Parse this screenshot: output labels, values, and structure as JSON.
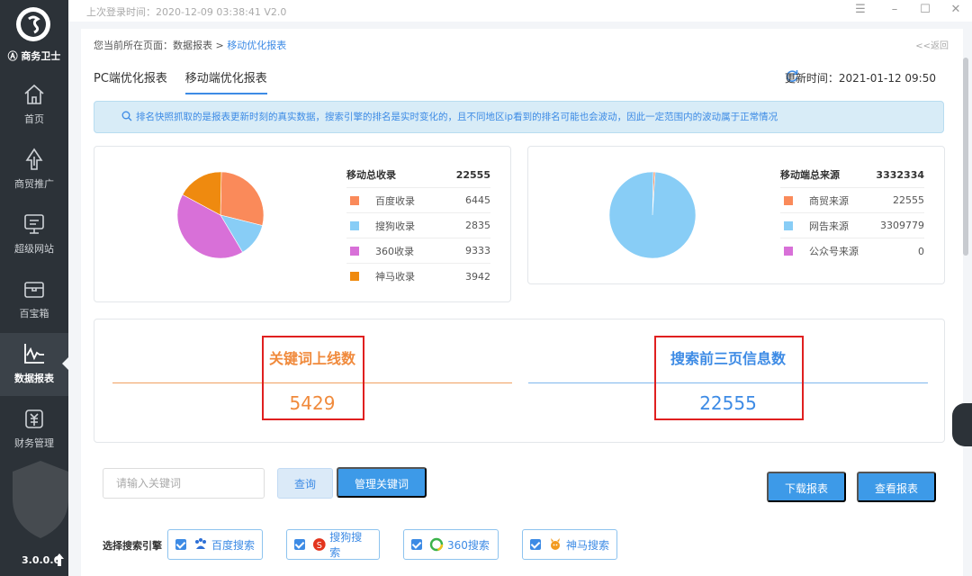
{
  "app": {
    "brand": "商务卫士",
    "last_login": "上次登录时间：2020-12-09 03:38:41 V2.0",
    "version": "3.0.0.6"
  },
  "sidebar": {
    "items": [
      {
        "label": "首页",
        "icon": "home-icon"
      },
      {
        "label": "商贸推广",
        "icon": "rocket-icon"
      },
      {
        "label": "超级网站",
        "icon": "monitor-icon"
      },
      {
        "label": "百宝箱",
        "icon": "treasure-box-icon"
      },
      {
        "label": "数据报表",
        "icon": "chart-line-icon",
        "active": true
      },
      {
        "label": "财务管理",
        "icon": "finance-icon"
      }
    ]
  },
  "breadcrumb": {
    "prefix": "您当前所在页面：数据报表 >",
    "current": "移动优化报表",
    "back": "<<返回"
  },
  "tabs": [
    {
      "label": "PC端优化报表",
      "active": false
    },
    {
      "label": "移动端优化报表",
      "active": true
    }
  ],
  "update_time": "更新时间：2021-01-12 09:50",
  "notice": "排名快照抓取的是报表更新时刻的真实数据，搜索引擎的排名是实时变化的，且不同地区ip看到的排名可能也会波动，因此一定范围内的波动属于正常情况",
  "colors": {
    "orange": "#fa8a5a",
    "light_blue": "#88cdf6",
    "purple": "#d870d8",
    "amber": "#ef8a0f",
    "accent": "#3d8be5"
  },
  "chart_data": [
    {
      "type": "pie",
      "title": "移动总收录",
      "total": "22555",
      "categories": [
        "百度收录",
        "搜狗收录",
        "360收录",
        "神马收录"
      ],
      "values": [
        6445,
        2835,
        9333,
        3942
      ],
      "colors": [
        "#fa8a5a",
        "#88cdf6",
        "#d870d8",
        "#ef8a0f"
      ]
    },
    {
      "type": "pie",
      "title": "移动端总来源",
      "total": "3332334",
      "categories": [
        "商贸来源",
        "网告来源",
        "公众号来源"
      ],
      "values": [
        22555,
        3309779,
        0
      ],
      "colors": [
        "#fa8a5a",
        "#88cdf6",
        "#d870d8"
      ]
    }
  ],
  "metrics": {
    "keywords_online": {
      "title": "关键词上线数",
      "value": "5429",
      "color": "#f08a3c"
    },
    "top3_pages": {
      "title": "搜索前三页信息数",
      "value": "22555",
      "color": "#3d8be5"
    }
  },
  "search": {
    "placeholder": "请输入关键词",
    "query_label": "查询",
    "manage_label": "管理关键词",
    "download_label": "下载报表",
    "view_label": "查看报表"
  },
  "engines": {
    "label": "选择搜索引擎",
    "items": [
      {
        "label": "百度搜索",
        "icon": "baidu-icon"
      },
      {
        "label": "搜狗搜索",
        "icon": "sogou-icon"
      },
      {
        "label": "360搜索",
        "icon": "so360-icon"
      },
      {
        "label": "神马搜索",
        "icon": "shenma-icon"
      }
    ]
  }
}
